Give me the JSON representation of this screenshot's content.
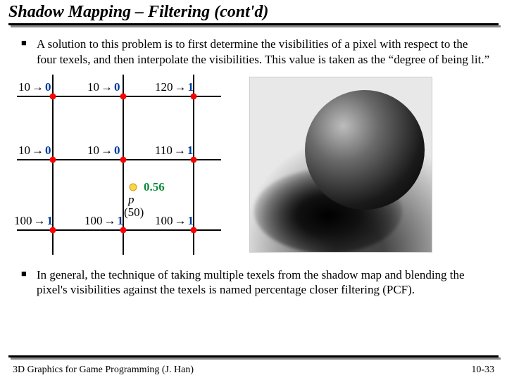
{
  "title": "Shadow Mapping – Filtering (cont'd)",
  "bullet1": "A solution to this problem is to first determine the visibilities of a pixel with respect to the four texels, and then interpolate the visibilities. This value is taken as the “degree of being lit.”",
  "bullet2": "In general, the technique of taking multiple texels from the shadow map and blending the pixel's visibilities against the texels is named percentage closer filtering (PCF).",
  "grid": {
    "r0c0_d": "10",
    "r0c0_v": "0",
    "r0c1_d": "10",
    "r0c1_v": "0",
    "r0c2_d": "120",
    "r0c2_v": "1",
    "r1c0_d": "10",
    "r1c0_v": "0",
    "r1c1_d": "10",
    "r1c1_v": "0",
    "r1c2_d": "110",
    "r1c2_v": "1",
    "r2c0_d": "100",
    "r2c0_v": "1",
    "r2c1_d": "100",
    "r2c1_v": "1",
    "r2c2_d": "100",
    "r2c2_v": "1",
    "p_label": "p",
    "p_depth": "(50)",
    "p_value": "0.56"
  },
  "footer_left": "3D Graphics for Game Programming (J. Han)",
  "footer_right": "10-33"
}
